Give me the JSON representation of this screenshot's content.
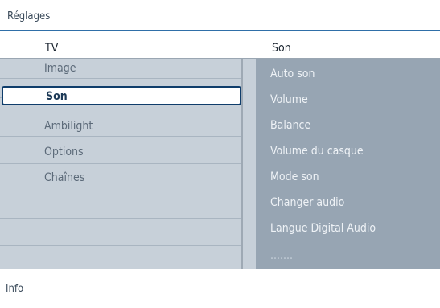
{
  "header": {
    "title": "Réglages"
  },
  "columns": {
    "left_title": "TV",
    "right_title": "Son"
  },
  "menu": {
    "items": [
      {
        "label": "Image"
      },
      {
        "label": "Son"
      },
      {
        "label": "Ambilight"
      },
      {
        "label": "Options"
      },
      {
        "label": "Chaînes"
      }
    ],
    "selected": "Son"
  },
  "submenu": {
    "items": [
      {
        "label": "Auto son"
      },
      {
        "label": "Volume"
      },
      {
        "label": "Balance"
      },
      {
        "label": "Volume du casque"
      },
      {
        "label": "Mode son"
      },
      {
        "label": "Changer audio"
      },
      {
        "label": "Langue Digital Audio"
      },
      {
        "label": "......."
      }
    ]
  },
  "footer": {
    "info": "Info"
  },
  "colors": {
    "accent": "#2f6fa8",
    "left_bg": "#c7d0d9",
    "right_bg": "#97a5b3",
    "selection_border": "#0f3d6b"
  }
}
